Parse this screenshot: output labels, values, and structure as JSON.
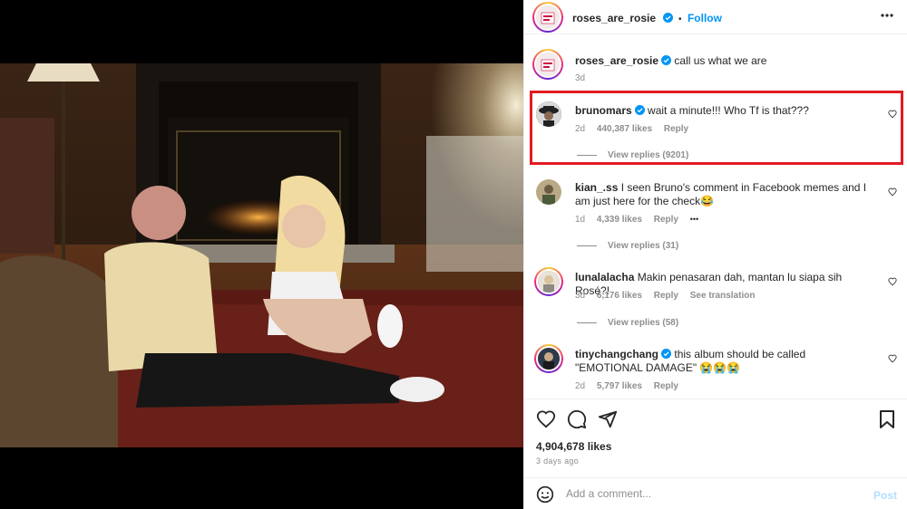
{
  "header": {
    "username": "roses_are_rosie",
    "separator": "•",
    "follow_label": "Follow",
    "more_icon": "more-horizontal-icon"
  },
  "caption": {
    "username": "roses_are_rosie",
    "text": "call us what we are",
    "time": "3d"
  },
  "comments": [
    {
      "username": "brunomars",
      "verified": true,
      "text": "wait a minute!!! Who Tf is that???",
      "time": "2d",
      "likes": "440,387 likes",
      "reply": "Reply",
      "view_replies": "View replies (9201)"
    },
    {
      "username": "kian_.ss",
      "verified": false,
      "text": "I seen Bruno's comment in Facebook memes and I am just here for the check😂",
      "time": "1d",
      "likes": "4,339 likes",
      "reply": "Reply",
      "extra": "•••",
      "view_replies": "View replies (31)"
    },
    {
      "username": "lunalalacha",
      "verified": false,
      "text": "Makin penasaran dah, mantan lu siapa sih Rosé?!",
      "time": "3d",
      "likes": "6,176 likes",
      "reply": "Reply",
      "extra": "See translation",
      "view_replies": "View replies (58)"
    },
    {
      "username": "tinychangchang",
      "verified": true,
      "text": "this album should be called \"EMOTIONAL DAMAGE\" 😭😭😭",
      "time": "2d",
      "likes": "5,797 likes",
      "reply": "Reply"
    }
  ],
  "post": {
    "likes": "4,904,678 likes",
    "ago": "3 days ago"
  },
  "add_comment": {
    "placeholder": "Add a comment...",
    "post_label": "Post"
  },
  "colors": {
    "accent": "#0095f6",
    "highlight": "#e21b23",
    "verified": "#0095f6"
  }
}
